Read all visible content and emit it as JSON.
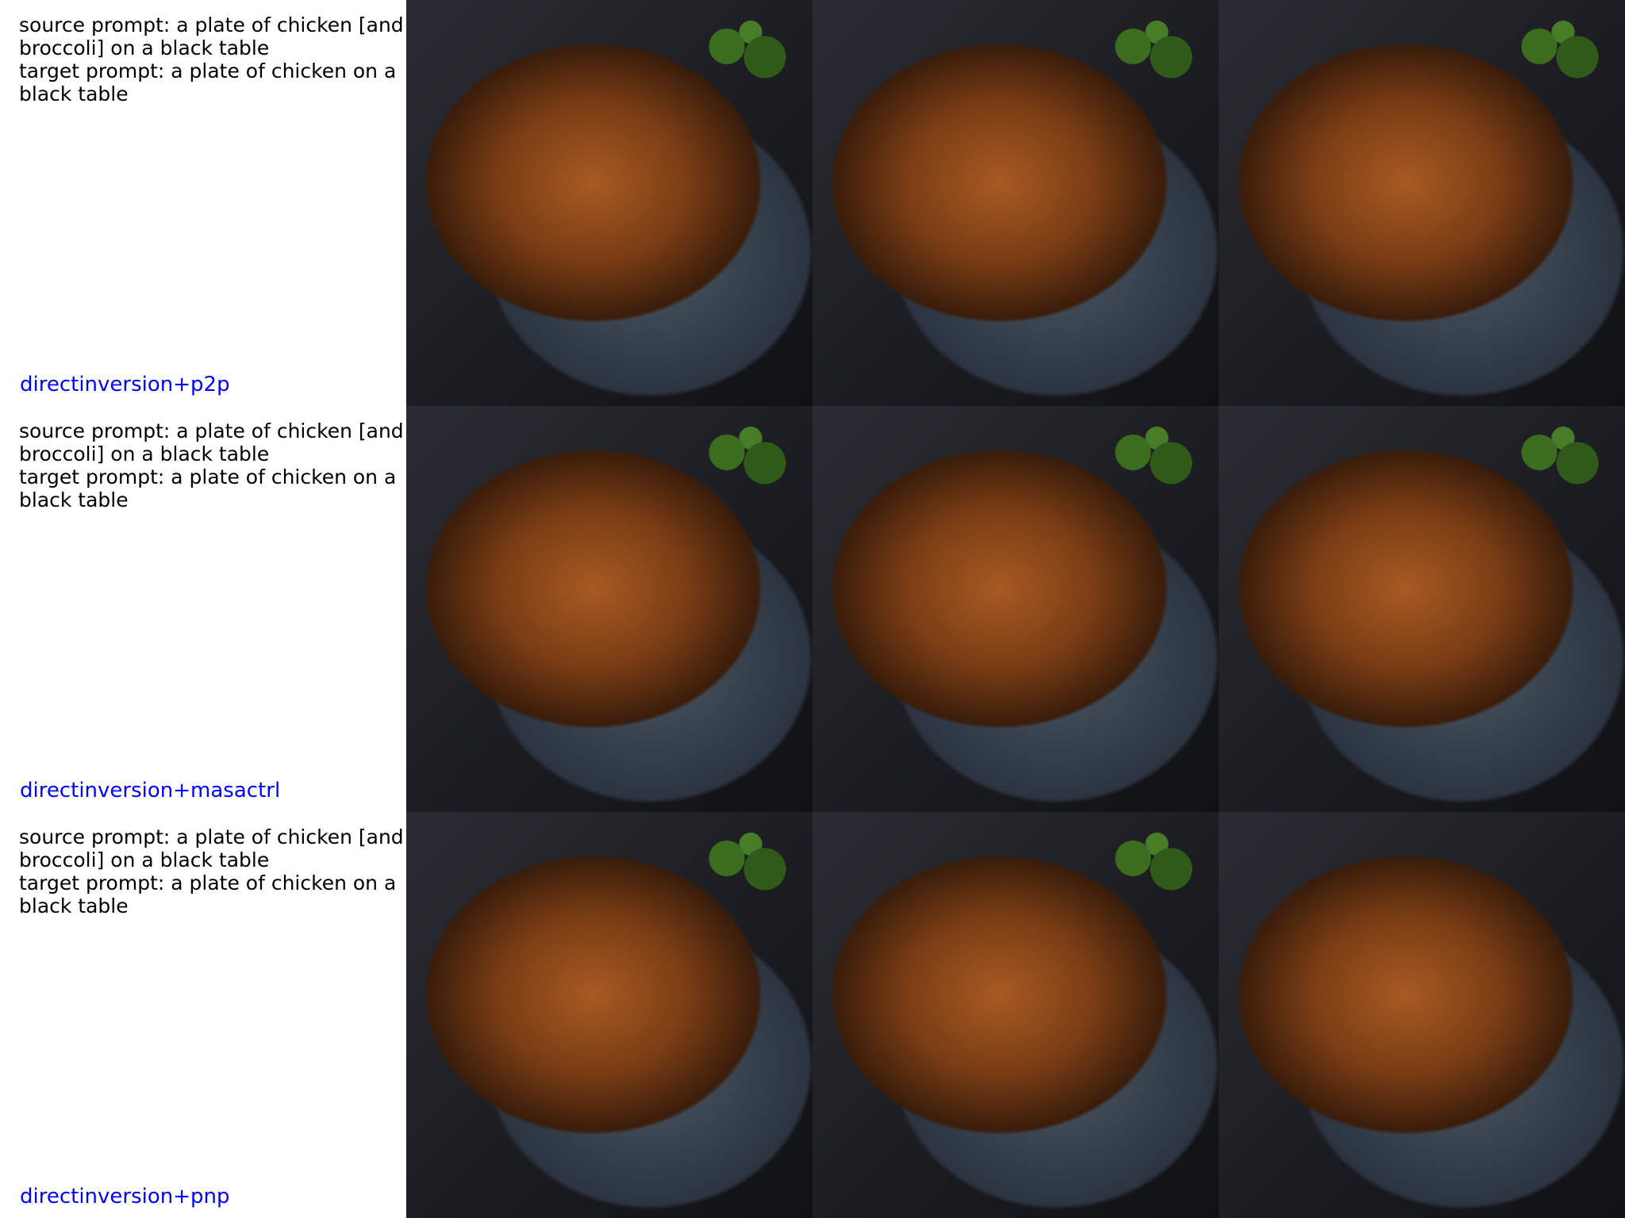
{
  "rows": [
    {
      "source_prompt": "source prompt: a plate of chicken [and broccoli] on a black table",
      "target_prompt": "target prompt: a plate of chicken on a black table",
      "method": "directinversion+p2p"
    },
    {
      "source_prompt": "source prompt: a plate of chicken [and broccoli] on a black table",
      "target_prompt": "target prompt: a plate of chicken on a black table",
      "method": "directinversion+masactrl"
    },
    {
      "source_prompt": "source prompt: a plate of chicken [and broccoli] on a black table",
      "target_prompt": "target prompt: a plate of chicken on a black table",
      "method": "directinversion+pnp"
    }
  ],
  "colors": {
    "method_label": "#0000ff",
    "prompt_text": "#000000"
  },
  "images": {
    "subject": "roasted chicken on a dark plate with broccoli on a black table"
  }
}
